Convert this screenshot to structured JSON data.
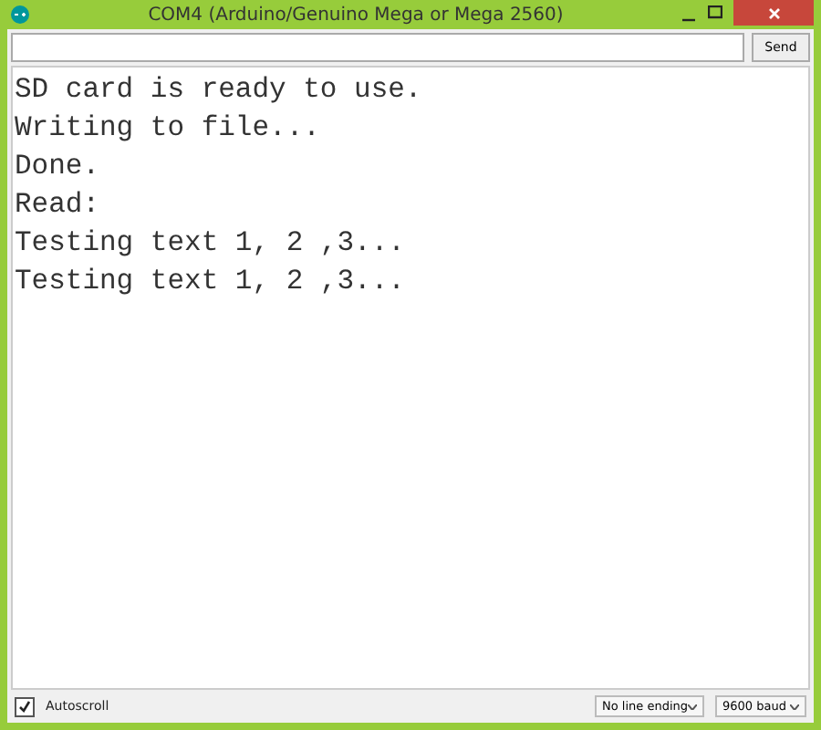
{
  "window": {
    "title": "COM4 (Arduino/Genuino Mega or Mega 2560)"
  },
  "send_button": {
    "label": "Send"
  },
  "output_lines": [
    "SD card is ready to use.",
    "Writing to file...",
    "Done.",
    "Read:",
    "Testing text 1, 2 ,3...",
    "Testing text 1, 2 ,3..."
  ],
  "autoscroll": {
    "label": "Autoscroll",
    "checked": true
  },
  "line_ending": {
    "value": "No line ending"
  },
  "baud_rate": {
    "value": "9600 baud"
  }
}
